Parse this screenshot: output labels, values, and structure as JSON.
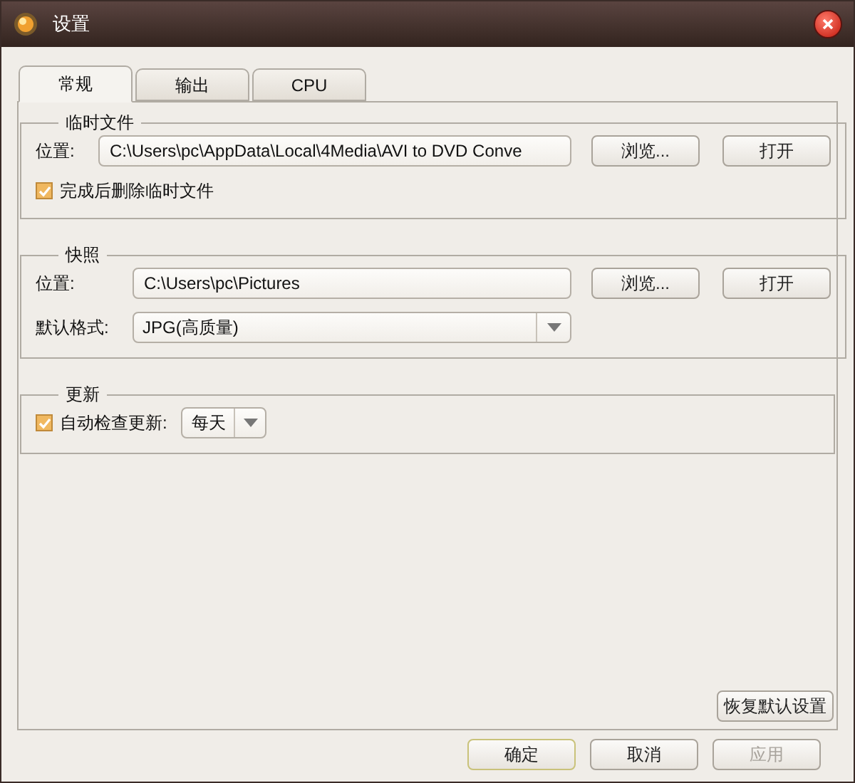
{
  "window": {
    "title": "设置"
  },
  "tabs": [
    {
      "label": "常规",
      "selected": true
    },
    {
      "label": "输出",
      "selected": false
    },
    {
      "label": "CPU",
      "selected": false
    }
  ],
  "temp_files": {
    "title": "临时文件",
    "location_label": "位置:",
    "location_value": "C:\\Users\\pc\\AppData\\Local\\4Media\\AVI to DVD Conve",
    "browse": "浏览...",
    "open": "打开",
    "delete_after": {
      "label": "完成后删除临时文件",
      "checked": true
    }
  },
  "snapshot": {
    "title": "快照",
    "location_label": "位置:",
    "location_value": "C:\\Users\\pc\\Pictures",
    "browse": "浏览...",
    "open": "打开",
    "format_label": "默认格式:",
    "format_value": "JPG(高质量)"
  },
  "update": {
    "title": "更新",
    "auto_check": {
      "label": "自动检查更新:",
      "checked": true
    },
    "frequency": "每天"
  },
  "restore_defaults": "恢复默认设置",
  "buttons": [
    {
      "label": "确定",
      "kind": "default",
      "disabled": false
    },
    {
      "label": "取消",
      "kind": "normal",
      "disabled": false
    },
    {
      "label": "应用",
      "kind": "normal",
      "disabled": true
    }
  ]
}
